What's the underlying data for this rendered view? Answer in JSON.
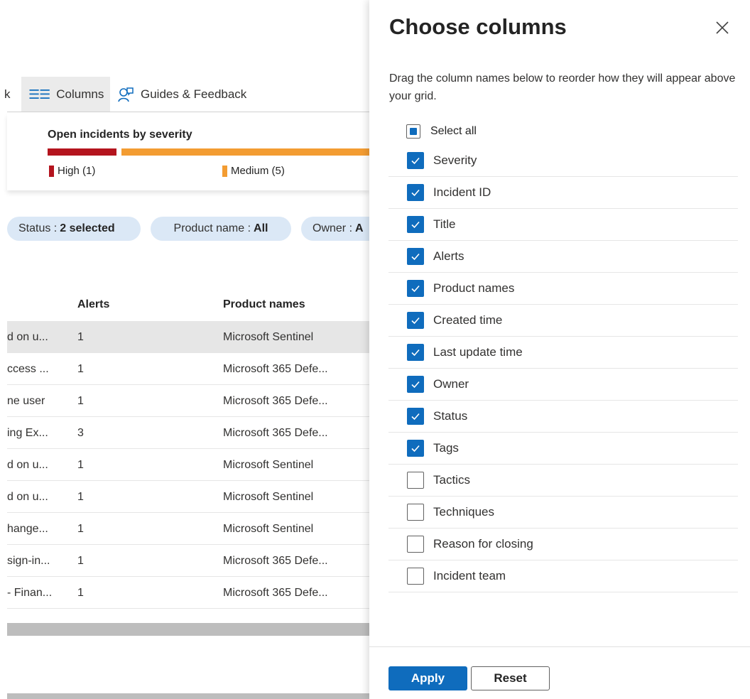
{
  "toolbar": {
    "partial_label": "k",
    "columns_label": "Columns",
    "guides_label": "Guides & Feedback"
  },
  "severity_card": {
    "title": "Open incidents by severity",
    "high_label": "High (1)",
    "medium_label": "Medium (5)"
  },
  "filters": {
    "status_key": "Status :",
    "status_value": "2 selected",
    "product_key": "Product name :",
    "product_value": "All",
    "owner_key": "Owner :",
    "owner_value": "A"
  },
  "grid": {
    "headers": {
      "alerts": "Alerts",
      "product": "Product names"
    },
    "rows": [
      {
        "title": "d on u...",
        "alerts": "1",
        "product": "Microsoft Sentinel"
      },
      {
        "title": "ccess ...",
        "alerts": "1",
        "product": "Microsoft 365 Defe..."
      },
      {
        "title": "ne user",
        "alerts": "1",
        "product": "Microsoft 365 Defe..."
      },
      {
        "title": "ing Ex...",
        "alerts": "3",
        "product": "Microsoft 365 Defe..."
      },
      {
        "title": "d on u...",
        "alerts": "1",
        "product": "Microsoft Sentinel"
      },
      {
        "title": "d on u...",
        "alerts": "1",
        "product": "Microsoft Sentinel"
      },
      {
        "title": "hange...",
        "alerts": "1",
        "product": "Microsoft Sentinel"
      },
      {
        "title": "sign-in...",
        "alerts": "1",
        "product": "Microsoft 365 Defe..."
      },
      {
        "title": "- Finan...",
        "alerts": "1",
        "product": "Microsoft 365 Defe..."
      }
    ]
  },
  "panel": {
    "title": "Choose columns",
    "description": "Drag the column names below to reorder how they will appear above your grid.",
    "select_all": "Select all",
    "columns": [
      {
        "label": "Severity",
        "checked": true
      },
      {
        "label": "Incident ID",
        "checked": true
      },
      {
        "label": "Title",
        "checked": true
      },
      {
        "label": "Alerts",
        "checked": true
      },
      {
        "label": "Product names",
        "checked": true
      },
      {
        "label": "Created time",
        "checked": true
      },
      {
        "label": "Last update time",
        "checked": true
      },
      {
        "label": "Owner",
        "checked": true
      },
      {
        "label": "Status",
        "checked": true
      },
      {
        "label": "Tags",
        "checked": true
      },
      {
        "label": "Tactics",
        "checked": false
      },
      {
        "label": "Techniques",
        "checked": false
      },
      {
        "label": "Reason for closing",
        "checked": false
      },
      {
        "label": "Incident team",
        "checked": false
      }
    ],
    "apply_label": "Apply",
    "reset_label": "Reset"
  },
  "colors": {
    "accent": "#0f6cbd",
    "severity_high": "#b4141e",
    "severity_medium": "#f39c32",
    "filter_pill": "#dbe8f6"
  }
}
